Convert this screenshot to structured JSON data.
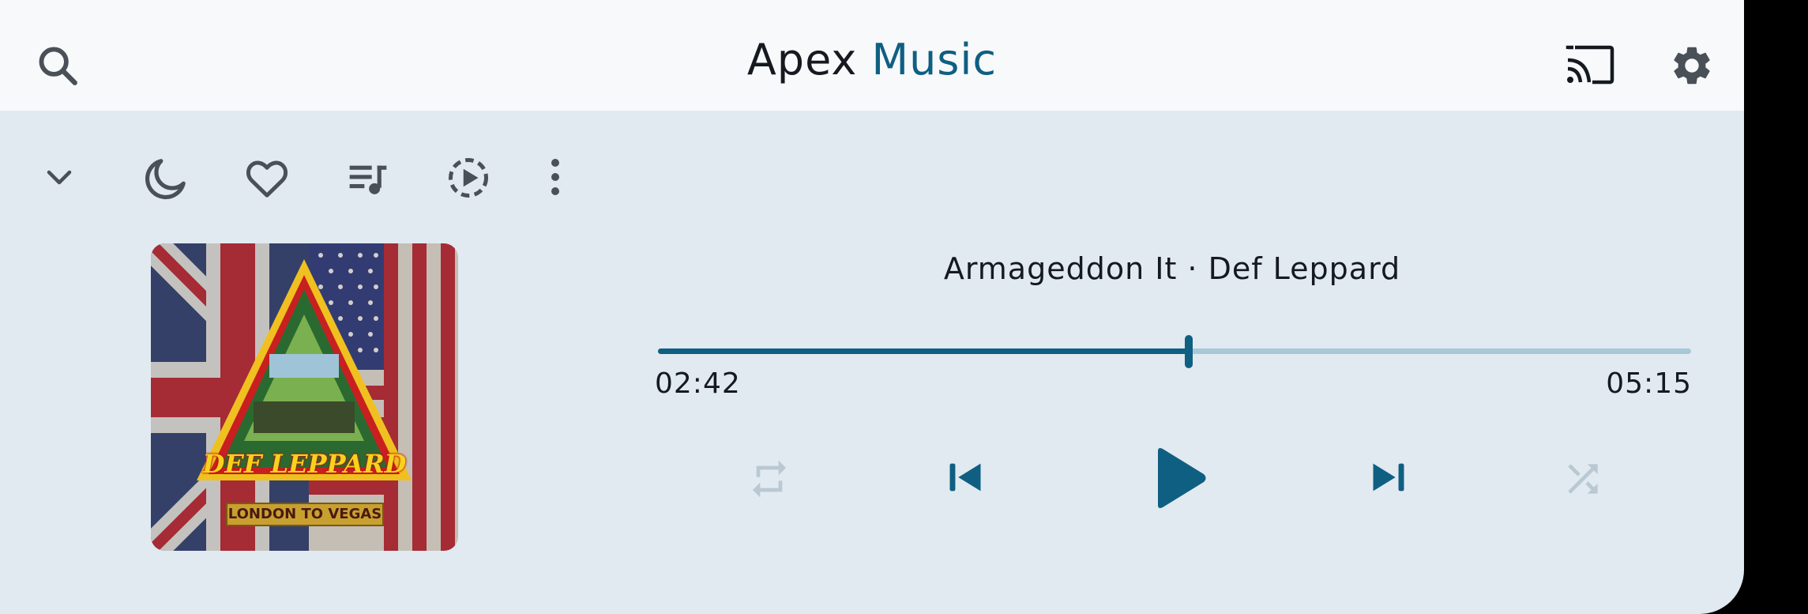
{
  "app": {
    "title_part1": "Apex",
    "title_part2": "Music"
  },
  "header_icons": [
    "search-icon",
    "cast-icon",
    "settings-icon"
  ],
  "toolbar_icons": [
    "chevron-down-icon",
    "sleep-timer-moon-icon",
    "favorite-heart-icon",
    "playlist-icon",
    "playback-speed-icon",
    "more-options-icon"
  ],
  "player": {
    "song": "Armageddon It · Def Leppard",
    "elapsed": "02:42",
    "duration": "05:15",
    "progress_fraction": 0.514,
    "controls": [
      "repeat-icon",
      "previous-icon",
      "play-icon",
      "next-icon",
      "shuffle-icon"
    ]
  },
  "album_art": {
    "logo_text": "DEF LEPPARD",
    "subtitle": "LONDON TO VEGAS"
  },
  "colors": {
    "accent": "#0f5f82",
    "icon_grey": "#4a5057",
    "disabled": "#b9c8d2",
    "background": "#e1eaf0",
    "appbar": "#f7f9fb"
  }
}
